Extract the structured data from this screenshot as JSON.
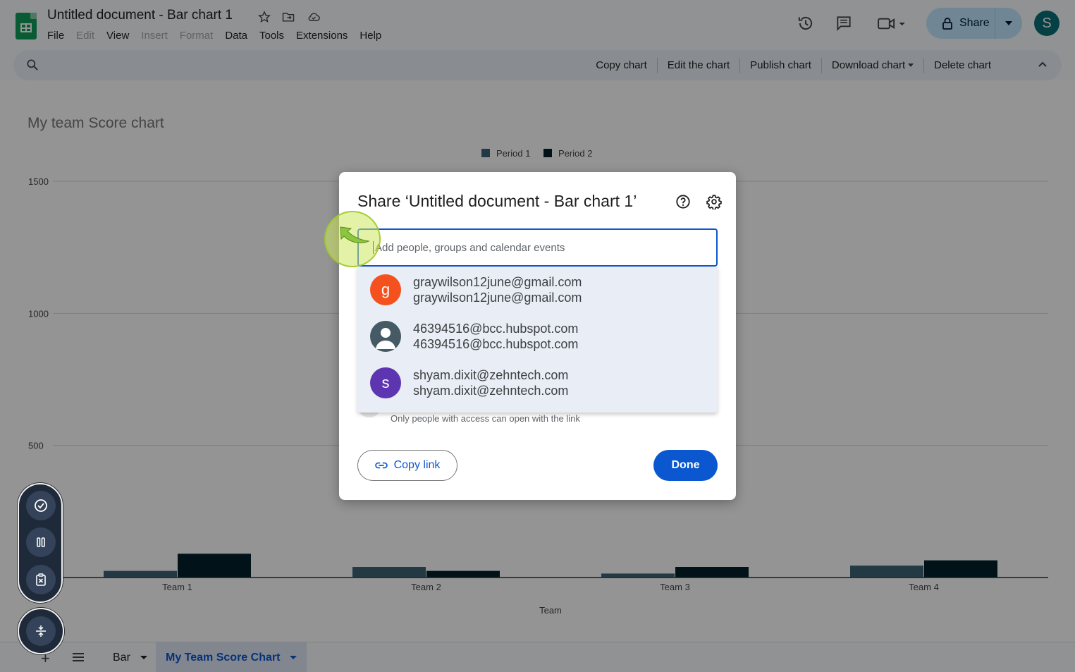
{
  "header": {
    "doc_title": "Untitled document - Bar chart 1",
    "menu": [
      "File",
      "Edit",
      "View",
      "Insert",
      "Format",
      "Data",
      "Tools",
      "Extensions",
      "Help"
    ],
    "menu_disabled": [
      "Edit",
      "Insert",
      "Format"
    ],
    "share_label": "Share",
    "avatar_letter": "S"
  },
  "chart_toolbar": {
    "actions": [
      "Copy chart",
      "Edit the chart",
      "Publish chart",
      "Download chart",
      "Delete chart"
    ]
  },
  "chart_data": {
    "type": "bar",
    "title": "My team Score chart",
    "xlabel": "Team",
    "ylabel": "",
    "categories": [
      "Team 1",
      "Team 2",
      "Team 3",
      "Team 4"
    ],
    "series": [
      {
        "name": "Period 1",
        "values": [
          25,
          40,
          15,
          45
        ],
        "color": "#3d6478"
      },
      {
        "name": "Period 2",
        "values": [
          90,
          25,
          40,
          65
        ],
        "color": "#03212b"
      }
    ],
    "ylim": [
      0,
      1500
    ],
    "yticks": [
      500,
      1000,
      1500
    ],
    "legend_position": "top",
    "grid": true
  },
  "dialog": {
    "title": "Share ‘Untitled document - Bar chart 1’",
    "input_placeholder": "Add people, groups and calendar events",
    "suggestions": [
      {
        "line1": "graywilson12june@gmail.com",
        "line2": "graywilson12june@gmail.com",
        "avatar": "g",
        "color": "#f4511e"
      },
      {
        "line1": "46394516@bcc.hubspot.com",
        "line2": "46394516@bcc.hubspot.com",
        "avatar": "",
        "color": "#455a64"
      },
      {
        "line1": "shyam.dixit@zehntech.com",
        "line2": "shyam.dixit@zehntech.com",
        "avatar": "s",
        "color": "#5e35b1"
      }
    ],
    "access_subtitle": "Only people with access can open with the link",
    "copy_link_label": "Copy link",
    "done_label": "Done"
  },
  "sheets": {
    "tabs": [
      "Bar",
      "My Team Score Chart"
    ],
    "active": "My Team Score Chart"
  }
}
